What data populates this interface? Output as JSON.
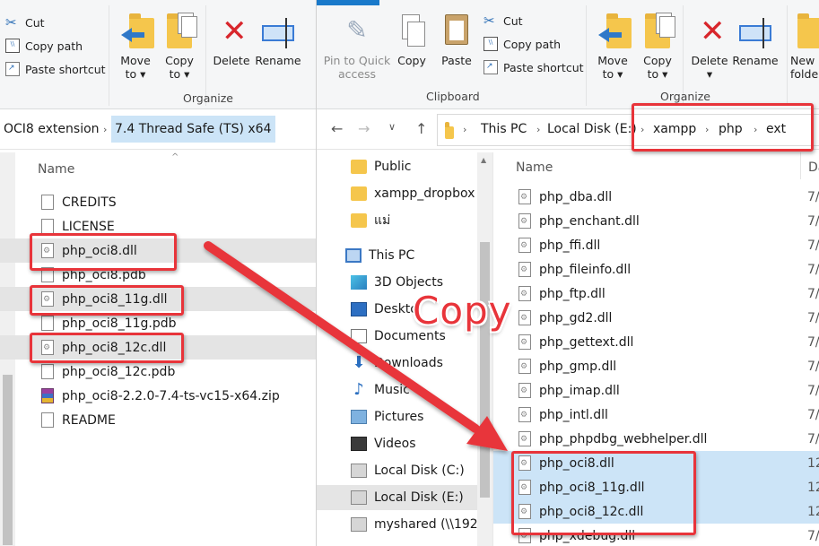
{
  "left": {
    "clipboard": {
      "cut": "Cut",
      "copy_path": "Copy path",
      "paste_shortcut": "Paste shortcut"
    },
    "organize": {
      "move_to": [
        "Move",
        "to ▾"
      ],
      "copy_to": [
        "Copy",
        "to ▾"
      ],
      "delete": "Delete",
      "rename": "Rename",
      "label": "Organize"
    },
    "address": {
      "crumb_parent": "OCI8 extension",
      "crumb_current": "7.4 Thread Safe (TS) x64"
    },
    "column_name": "Name",
    "files": [
      {
        "name": "CREDITS",
        "type": "file"
      },
      {
        "name": "LICENSE",
        "type": "file"
      },
      {
        "name": "php_oci8.dll",
        "type": "dll"
      },
      {
        "name": "php_oci8.pdb",
        "type": "file"
      },
      {
        "name": "php_oci8_11g.dll",
        "type": "dll"
      },
      {
        "name": "php_oci8_11g.pdb",
        "type": "file"
      },
      {
        "name": "php_oci8_12c.dll",
        "type": "dll"
      },
      {
        "name": "php_oci8_12c.pdb",
        "type": "file"
      },
      {
        "name": "php_oci8-2.2.0-7.4-ts-vc15-x64.zip",
        "type": "zip"
      },
      {
        "name": "README",
        "type": "file"
      }
    ]
  },
  "right": {
    "clipboard": {
      "pin": [
        "Pin to Quick",
        "access"
      ],
      "copy": "Copy",
      "paste": "Paste",
      "cut": "Cut",
      "copy_path": "Copy path",
      "paste_shortcut": "Paste shortcut",
      "label": "Clipboard"
    },
    "organize": {
      "move_to": [
        "Move",
        "to ▾"
      ],
      "copy_to": [
        "Copy",
        "to ▾"
      ],
      "delete": [
        "Delete",
        "▾"
      ],
      "rename": "Rename",
      "label": "Organize"
    },
    "new_folder": [
      "New",
      "folde"
    ],
    "address": {
      "crumbs": [
        "This PC",
        "Local Disk (E:)",
        "xampp",
        "php",
        "ext"
      ]
    },
    "nav": [
      {
        "label": "Public",
        "icon": "folder-sync-icon"
      },
      {
        "label": "xampp_dropbox",
        "icon": "folder-sync-icon"
      },
      {
        "label": "แม่",
        "icon": "folder-sync-icon"
      },
      {
        "label": "This PC",
        "icon": "pc-icon"
      },
      {
        "label": "3D Objects",
        "icon": "cube-icon"
      },
      {
        "label": "Deskto",
        "icon": "desktop-icon"
      },
      {
        "label": "Documents",
        "icon": "documents-icon"
      },
      {
        "label": "Downloads",
        "icon": "download-icon"
      },
      {
        "label": "Music",
        "icon": "music-icon"
      },
      {
        "label": "Pictures",
        "icon": "pictures-icon"
      },
      {
        "label": "Videos",
        "icon": "videos-icon"
      },
      {
        "label": "Local Disk (C:)",
        "icon": "drive-c-icon"
      },
      {
        "label": "Local Disk (E:)",
        "icon": "drive-icon"
      },
      {
        "label": "myshared (\\\\192",
        "icon": "network-drive-icon"
      }
    ],
    "columns": {
      "name": "Name",
      "date": "Da"
    },
    "files": [
      {
        "name": "php_dba.dll",
        "date": "7/"
      },
      {
        "name": "php_enchant.dll",
        "date": "7/"
      },
      {
        "name": "php_ffi.dll",
        "date": "7/"
      },
      {
        "name": "php_fileinfo.dll",
        "date": "7/"
      },
      {
        "name": "php_ftp.dll",
        "date": "7/"
      },
      {
        "name": "php_gd2.dll",
        "date": "7/"
      },
      {
        "name": "php_gettext.dll",
        "date": "7/"
      },
      {
        "name": "php_gmp.dll",
        "date": "7/"
      },
      {
        "name": "php_imap.dll",
        "date": "7/"
      },
      {
        "name": "php_intl.dll",
        "date": "7/"
      },
      {
        "name": "php_phpdbg_webhelper.dll",
        "date": "7/"
      },
      {
        "name": "php_oci8.dll",
        "date": "12"
      },
      {
        "name": "php_oci8_11g.dll",
        "date": "12"
      },
      {
        "name": "php_oci8_12c.dll",
        "date": "12"
      },
      {
        "name": "php_xdebug.dll",
        "date": "7/"
      }
    ]
  },
  "annotation": {
    "copy_label": "Copy",
    "color": "#e8343a"
  }
}
